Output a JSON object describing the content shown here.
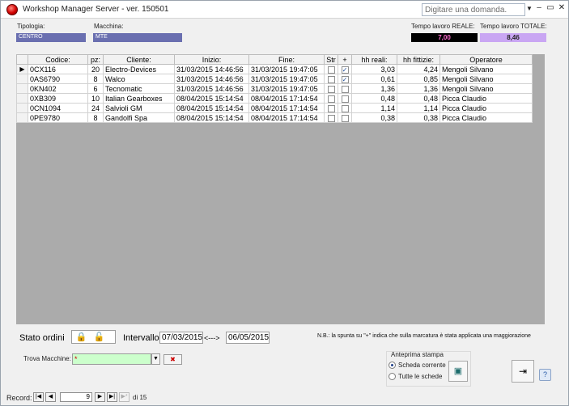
{
  "window": {
    "title": "Workshop Manager Server - ver. 150501",
    "help_placeholder": "Digitare una domanda.",
    "minimize": "–",
    "restore": "▭",
    "close": "✕"
  },
  "header": {
    "tipologia_label": "Tipologia:",
    "tipologia_value": "CENTRO",
    "macchina_label": "Macchina:",
    "macchina_value": "MTE",
    "reale_label": "Tempo lavoro REALE:",
    "reale_value": "7,00",
    "totale_label": "Tempo lavoro TOTALE:",
    "totale_value": "8,46"
  },
  "grid": {
    "columns": [
      "Codice:",
      "pz:",
      "Cliente:",
      "Inizio:",
      "Fine:",
      "Str",
      "+",
      "hh reali:",
      "hh fittizie:",
      "Operatore"
    ],
    "rows": [
      {
        "codice": "0CX116",
        "pz": "20",
        "cliente": "Electro-Devices",
        "inizio": "31/03/2015 14:46:56",
        "fine": "31/03/2015 19:47:05",
        "str": "",
        "plus": "✓",
        "hh_reali": "3,03",
        "hh_fittizie": "4,24",
        "operatore": "Mengoli Silvano",
        "selected": "▶"
      },
      {
        "codice": "0AS6790",
        "pz": "8",
        "cliente": "Walco",
        "inizio": "31/03/2015 14:46:56",
        "fine": "31/03/2015 19:47:05",
        "str": "",
        "plus": "✓",
        "hh_reali": "0,61",
        "hh_fittizie": "0,85",
        "operatore": "Mengoli Silvano",
        "selected": ""
      },
      {
        "codice": "0KN402",
        "pz": "6",
        "cliente": "Tecnomatic",
        "inizio": "31/03/2015 14:46:56",
        "fine": "31/03/2015 19:47:05",
        "str": "",
        "plus": "",
        "hh_reali": "1,36",
        "hh_fittizie": "1,36",
        "operatore": "Mengoli Silvano",
        "selected": ""
      },
      {
        "codice": "0XB309",
        "pz": "10",
        "cliente": "Italian Gearboxes",
        "inizio": "08/04/2015 15:14:54",
        "fine": "08/04/2015 17:14:54",
        "str": "",
        "plus": "",
        "hh_reali": "0,48",
        "hh_fittizie": "0,48",
        "operatore": "Picca Claudio",
        "selected": ""
      },
      {
        "codice": "0CN1094",
        "pz": "24",
        "cliente": "Salvioli GM",
        "inizio": "08/04/2015 15:14:54",
        "fine": "08/04/2015 17:14:54",
        "str": "",
        "plus": "",
        "hh_reali": "1,14",
        "hh_fittizie": "1,14",
        "operatore": "Picca Claudio",
        "selected": ""
      },
      {
        "codice": "0PE9780",
        "pz": "8",
        "cliente": "Gandolfi Spa",
        "inizio": "08/04/2015 15:14:54",
        "fine": "08/04/2015 17:14:54",
        "str": "",
        "plus": "",
        "hh_reali": "0,38",
        "hh_fittizie": "0,38",
        "operatore": "Picca Claudio",
        "selected": ""
      }
    ]
  },
  "footer": {
    "stato_label": "Stato ordini",
    "lock_icons": "🔒🔓",
    "intervallo_label": "Intervallo",
    "date_from": "07/03/2015",
    "arrow": "<--->",
    "date_to": "06/05/2015",
    "note": "N.B.: la spunta su \"+\" indica che sulla marcatura è stata applicata una maggiorazione",
    "trova_label": "Trova Macchine:",
    "trova_value": "*",
    "trova_clear": "✖",
    "anteprima_title": "Anteprima stampa",
    "radio_corrente": "Scheda corrente",
    "radio_tutte": "Tutte le schede",
    "print_icon": "▣",
    "exit_icon": "⇥",
    "help_icon": "?"
  },
  "navigation": {
    "record_label": "Record:",
    "first": "|◀",
    "prev": "◀",
    "current": "9",
    "next": "▶",
    "last": "▶|",
    "new": "▶*",
    "of_label": "di 15"
  }
}
